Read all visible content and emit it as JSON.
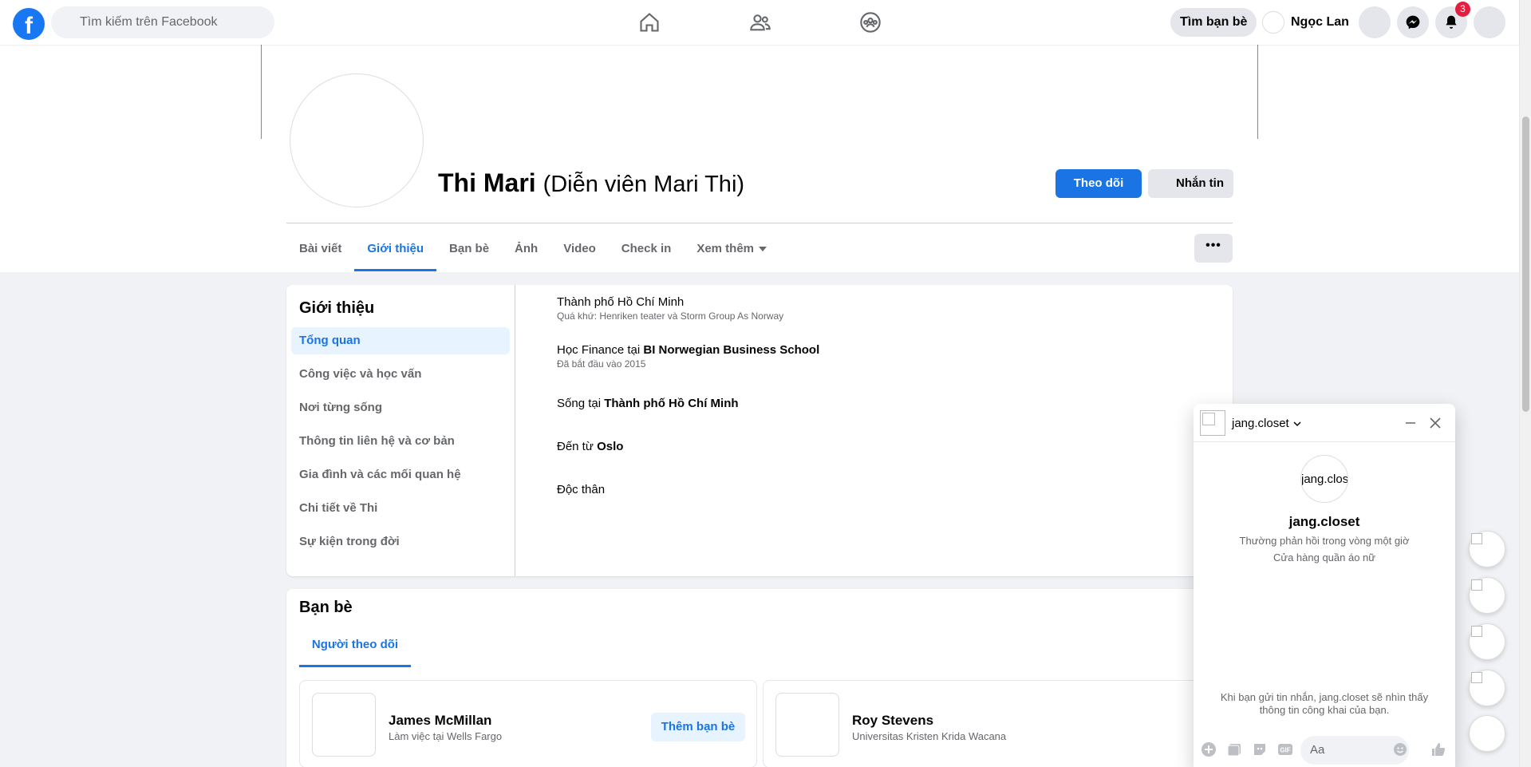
{
  "topbar": {
    "search_placeholder": "Tìm kiếm trên Facebook",
    "find_friends": "Tìm bạn bè",
    "user_name": "Ngọc Lan",
    "notification_count": "3"
  },
  "profile": {
    "name": "Thi Mari",
    "alt_name": "(Diễn viên Mari Thi)",
    "follow_label": "Theo dõi",
    "message_label": "Nhắn tin",
    "more_label": "•••",
    "tabs": [
      "Bài viết",
      "Giới thiệu",
      "Bạn bè",
      "Ảnh",
      "Video",
      "Check in",
      "Xem thêm"
    ]
  },
  "about": {
    "title": "Giới thiệu",
    "nav": [
      "Tổng quan",
      "Công việc và học vấn",
      "Nơi từng sống",
      "Thông tin liên hệ và cơ bản",
      "Gia đình và các mối quan hệ",
      "Chi tiết về Thi",
      "Sự kiện trong đời"
    ],
    "items": {
      "work_title": "Thành phố Hồ Chí Minh",
      "work_sub": "Quá khứ: Henriken teater và Storm Group As Norway",
      "study_prefix": "Học Finance tại ",
      "study_bold": "BI Norwegian Business School",
      "study_sub": "Đã bắt đầu vào 2015",
      "lives_prefix": "Sống tại ",
      "lives_bold": "Thành phố Hồ Chí Minh",
      "from_prefix": "Đến từ ",
      "from_bold": "Oslo",
      "relationship": "Độc thân"
    }
  },
  "friends": {
    "title": "Bạn bè",
    "tab": "Người theo dõi",
    "people": [
      {
        "name": "James McMillan",
        "desc": "Làm việc tại Wells Fargo",
        "action": "Thêm bạn bè"
      },
      {
        "name": "Roy Stevens",
        "desc": "Universitas Kristen Krida Wacana"
      }
    ]
  },
  "chat": {
    "name": "jang.closet",
    "avatar_alt": "jang.clos",
    "response": "Thường phản hồi trong vòng một giờ",
    "category": "Cửa hàng quần áo nữ",
    "privacy_note": "Khi bạn gửi tin nhắn, jang.closet sẽ nhìn thấy thông tin công khai của bạn.",
    "input_placeholder": "Aa",
    "gif_label": "GIF"
  },
  "colors": {
    "brand": "#1877f2",
    "accent": "#1b74e4",
    "badge": "#e41e3f"
  }
}
